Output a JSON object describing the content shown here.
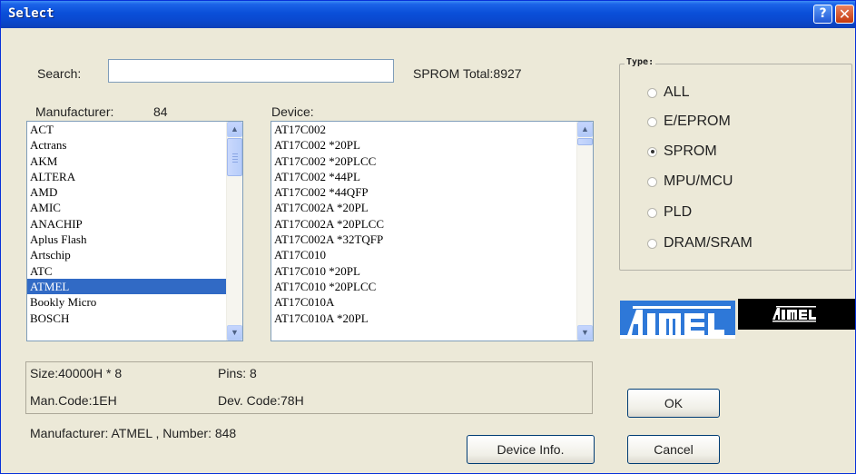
{
  "window": {
    "title": "Select",
    "help_glyph": "?",
    "close_glyph": "✕"
  },
  "search": {
    "label": "Search:",
    "value": "",
    "total": "SPROM Total:8927"
  },
  "manufacturer": {
    "label": "Manufacturer:",
    "count": "84",
    "items": [
      "ACT",
      "Actrans",
      "AKM",
      "ALTERA",
      "AMD",
      "AMIC",
      "ANACHIP",
      "Aplus Flash",
      "Artschip",
      "ATC",
      "ATMEL",
      "Bookly Micro",
      "BOSCH"
    ],
    "selected": "ATMEL"
  },
  "device": {
    "label": "Device:",
    "items": [
      "AT17C002",
      "AT17C002 *20PL",
      "AT17C002 *20PLCC",
      "AT17C002 *44PL",
      "AT17C002 *44QFP",
      "AT17C002A *20PL",
      "AT17C002A *20PLCC",
      "AT17C002A *32TQFP",
      "AT17C010",
      "AT17C010 *20PL",
      "AT17C010 *20PLCC",
      "AT17C010A",
      "AT17C010A *20PL"
    ]
  },
  "type_group": {
    "title": "Type:",
    "options": [
      "ALL",
      "E/EPROM",
      "SPROM",
      "MPU/MCU",
      "PLD",
      "DRAM/SRAM"
    ],
    "selected": "SPROM"
  },
  "logos": {
    "blue_text": "AIMEL",
    "black_text": "AIMEL",
    "blue_color": "#2e78d8",
    "black_color": "#000000"
  },
  "info": {
    "size": "Size:40000H * 8",
    "pins": "Pins: 8",
    "man_code": "Man.Code:1EH",
    "dev_code": "Dev. Code:78H",
    "summary": "Manufacturer: ATMEL , Number: 848"
  },
  "buttons": {
    "device_info": "Device Info.",
    "ok": "OK",
    "cancel": "Cancel"
  },
  "icons": {
    "scroll_up": "▲",
    "scroll_down": "▼"
  },
  "colors": {
    "titlebar": "#0a4fd8",
    "selection": "#316ac5",
    "dialog_bg": "#ece9d8"
  }
}
